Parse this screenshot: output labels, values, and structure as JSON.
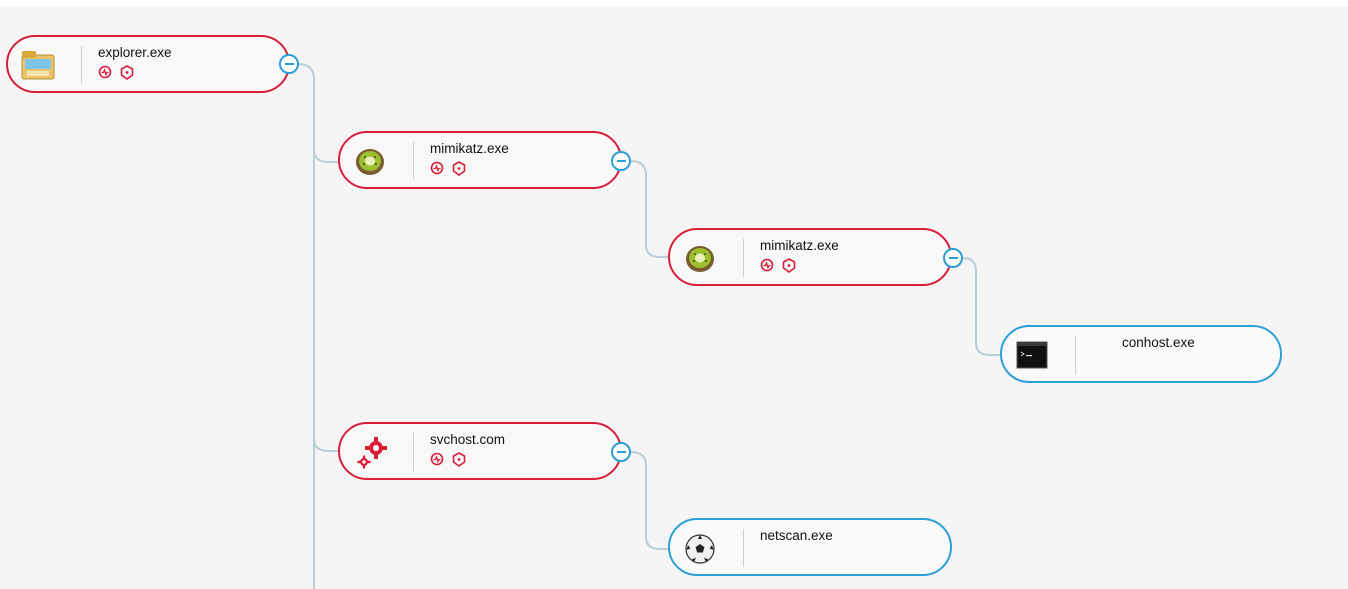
{
  "colors": {
    "malicious_border": "#d81e3a",
    "benign_border": "#2b9fd6",
    "connector": "#b9cdd6",
    "background": "#f5f5f5"
  },
  "badge_icons": [
    "activity-icon",
    "shield-icon"
  ],
  "nodes": [
    {
      "id": "n1",
      "name": "explorer.exe",
      "icon": "folder-icon",
      "status": "malicious",
      "collapse_toggle": "minus-icon"
    },
    {
      "id": "n2",
      "name": "mimikatz.exe",
      "icon": "kiwi-icon",
      "status": "malicious",
      "collapse_toggle": "minus-icon"
    },
    {
      "id": "n3",
      "name": "mimikatz.exe",
      "icon": "kiwi-icon",
      "status": "malicious",
      "collapse_toggle": "minus-icon"
    },
    {
      "id": "n4",
      "name": "conhost.exe",
      "icon": "console-icon",
      "status": "benign"
    },
    {
      "id": "n5",
      "name": "svchost.com",
      "icon": "gears-icon",
      "status": "malicious",
      "collapse_toggle": "minus-icon"
    },
    {
      "id": "n6",
      "name": "netscan.exe",
      "icon": "soccer-ball-icon",
      "status": "benign"
    }
  ]
}
